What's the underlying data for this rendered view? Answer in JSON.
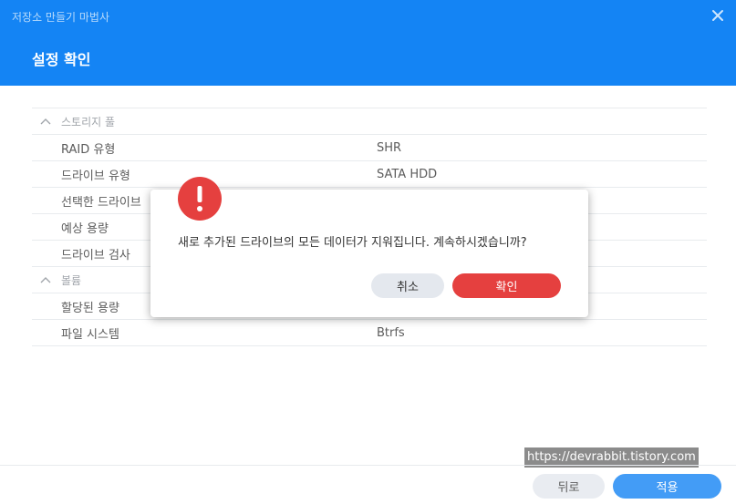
{
  "window": {
    "title": "저장소 만들기 마법사"
  },
  "header": {
    "title": "설정 확인"
  },
  "summary": {
    "sections": [
      {
        "label": "스토리지 풀",
        "rows": [
          {
            "label": "RAID 유형",
            "value": "SHR"
          },
          {
            "label": "드라이브 유형",
            "value": "SATA HDD"
          },
          {
            "label": "선택한 드라이브",
            "value": ""
          },
          {
            "label": "예상 용량",
            "value": ""
          },
          {
            "label": "드라이브 검사",
            "value": ""
          }
        ]
      },
      {
        "label": "볼륨",
        "rows": [
          {
            "label": "할당된 용량",
            "value": ""
          },
          {
            "label": "파일 시스템",
            "value": "Btrfs"
          }
        ]
      }
    ]
  },
  "footer": {
    "watermark": "https://devrabbit.tistory.com",
    "back_label": "뒤로",
    "apply_label": "적용"
  },
  "dialog": {
    "message": "새로 추가된 드라이브의 모든 데이터가 지워집니다. 계속하시겠습니까?",
    "cancel_label": "취소",
    "confirm_label": "확인"
  },
  "colors": {
    "accent": "#1484f4",
    "danger": "#e5403f",
    "secondary_button": "#e4e8ee"
  }
}
